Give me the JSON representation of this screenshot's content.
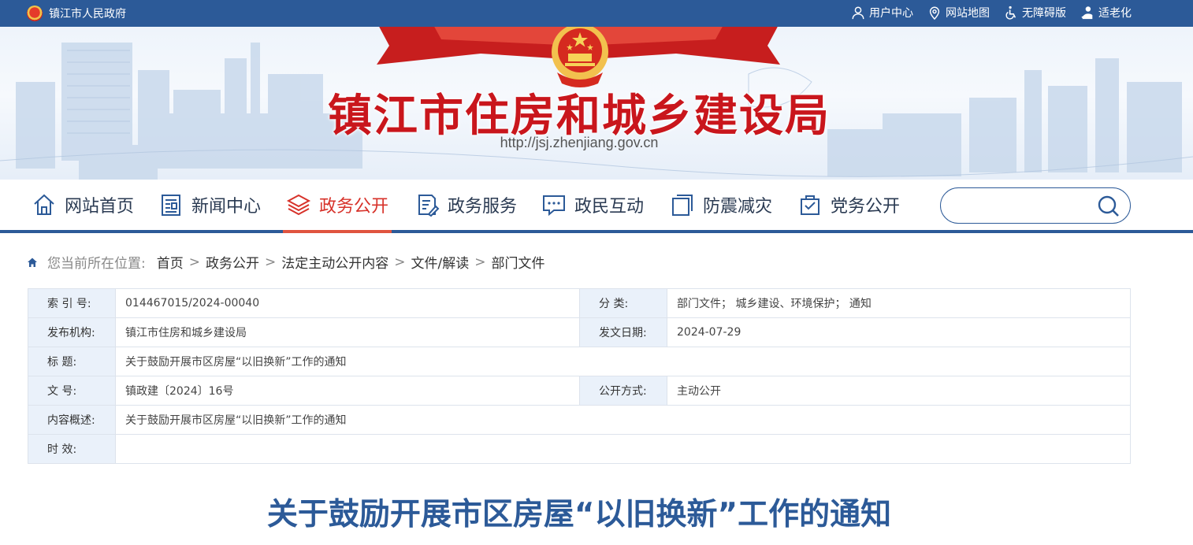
{
  "topbar": {
    "gov_name": "镇江市人民政府",
    "links": [
      "用户中心",
      "网站地图",
      "无障碍版",
      "适老化"
    ]
  },
  "banner": {
    "title": "镇江市住房和城乡建设局",
    "url": "http://jsj.zhenjiang.gov.cn"
  },
  "nav": {
    "items": [
      {
        "label": "网站首页",
        "icon": "home-icon"
      },
      {
        "label": "新闻中心",
        "icon": "newspaper-icon"
      },
      {
        "label": "政务公开",
        "icon": "layers-icon"
      },
      {
        "label": "政务服务",
        "icon": "document-edit-icon"
      },
      {
        "label": "政民互动",
        "icon": "chat-icon"
      },
      {
        "label": "防震减灾",
        "icon": "square-stack-icon"
      },
      {
        "label": "党务公开",
        "icon": "clipboard-icon"
      }
    ],
    "active_index": 2,
    "search_placeholder": ""
  },
  "breadcrumb": {
    "prefix": "您当前所在位置:",
    "items": [
      "首页",
      "政务公开",
      "法定主动公开内容",
      "文件/解读",
      "部门文件"
    ],
    "separator": ">"
  },
  "info": {
    "index_label": "索 引 号:",
    "index_value": "014467015/2024-00040",
    "category_label": "分    类:",
    "category_value": "部门文件； 城乡建设、环境保护； 通知",
    "publisher_label": "发布机构:",
    "publisher_value": "镇江市住房和城乡建设局",
    "date_label": "发文日期:",
    "date_value": "2024-07-29",
    "title_label": "标    题:",
    "title_value": "关于鼓励开展市区房屋“以旧换新”工作的通知",
    "docno_label": "文    号:",
    "docno_value": "镇政建〔2024〕16号",
    "open_label": "公开方式:",
    "open_value": "主动公开",
    "summary_label": "内容概述:",
    "summary_value": "关于鼓励开展市区房屋“以旧换新”工作的通知",
    "validity_label": "时    效:",
    "validity_value": ""
  },
  "article": {
    "title": "关于鼓励开展市区房屋“以旧换新”工作的通知"
  },
  "colors": {
    "primary_blue": "#2c5a98",
    "title_red": "#c9161c",
    "active_red": "#d7322a",
    "label_bg": "#eaf1fa"
  }
}
